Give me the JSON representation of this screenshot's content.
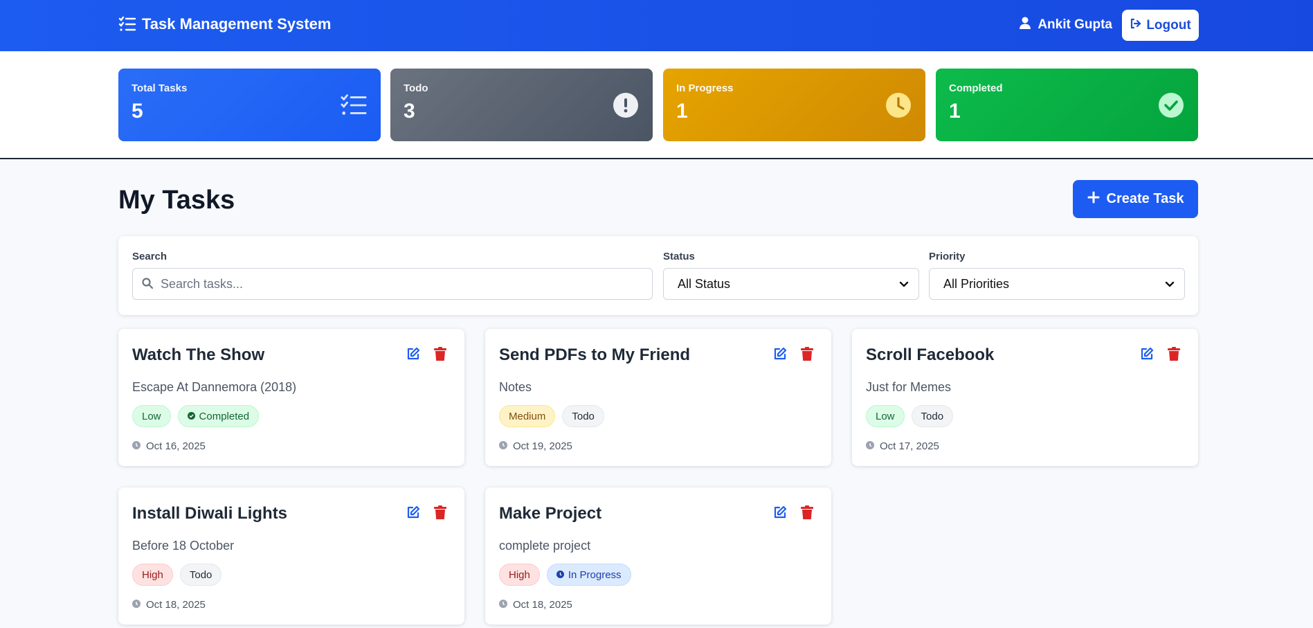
{
  "header": {
    "app_title": "Task Management System",
    "user_name": "Ankit Gupta",
    "logout_label": "Logout"
  },
  "stats": [
    {
      "label": "Total Tasks",
      "value": "5",
      "icon": "list-check-icon"
    },
    {
      "label": "Todo",
      "value": "3",
      "icon": "exclamation-circle-icon"
    },
    {
      "label": "In Progress",
      "value": "1",
      "icon": "clock-icon"
    },
    {
      "label": "Completed",
      "value": "1",
      "icon": "check-circle-icon"
    }
  ],
  "page": {
    "title": "My Tasks",
    "create_label": "Create Task"
  },
  "filters": {
    "search_label": "Search",
    "search_placeholder": "Search tasks...",
    "status_label": "Status",
    "status_value": "All Status",
    "priority_label": "Priority",
    "priority_value": "All Priorities"
  },
  "tasks": [
    {
      "title": "Watch The Show",
      "description": "Escape At Dannemora (2018)",
      "priority": "Low",
      "status": "Completed",
      "date": "Oct 16, 2025"
    },
    {
      "title": "Send PDFs to My Friend",
      "description": "Notes",
      "priority": "Medium",
      "status": "Todo",
      "date": "Oct 19, 2025"
    },
    {
      "title": "Scroll Facebook",
      "description": "Just for Memes",
      "priority": "Low",
      "status": "Todo",
      "date": "Oct 17, 2025"
    },
    {
      "title": "Install Diwali Lights",
      "description": "Before 18 October",
      "priority": "High",
      "status": "Todo",
      "date": "Oct 18, 2025"
    },
    {
      "title": "Make Project",
      "description": "complete project",
      "priority": "High",
      "status": "In Progress",
      "date": "Oct 18, 2025"
    }
  ],
  "colors": {
    "primary": "#1d5cf3",
    "todo_card": "#5b6472",
    "progress_card": "#dc9702",
    "completed_card": "#08b045",
    "delete": "#dc2626"
  }
}
